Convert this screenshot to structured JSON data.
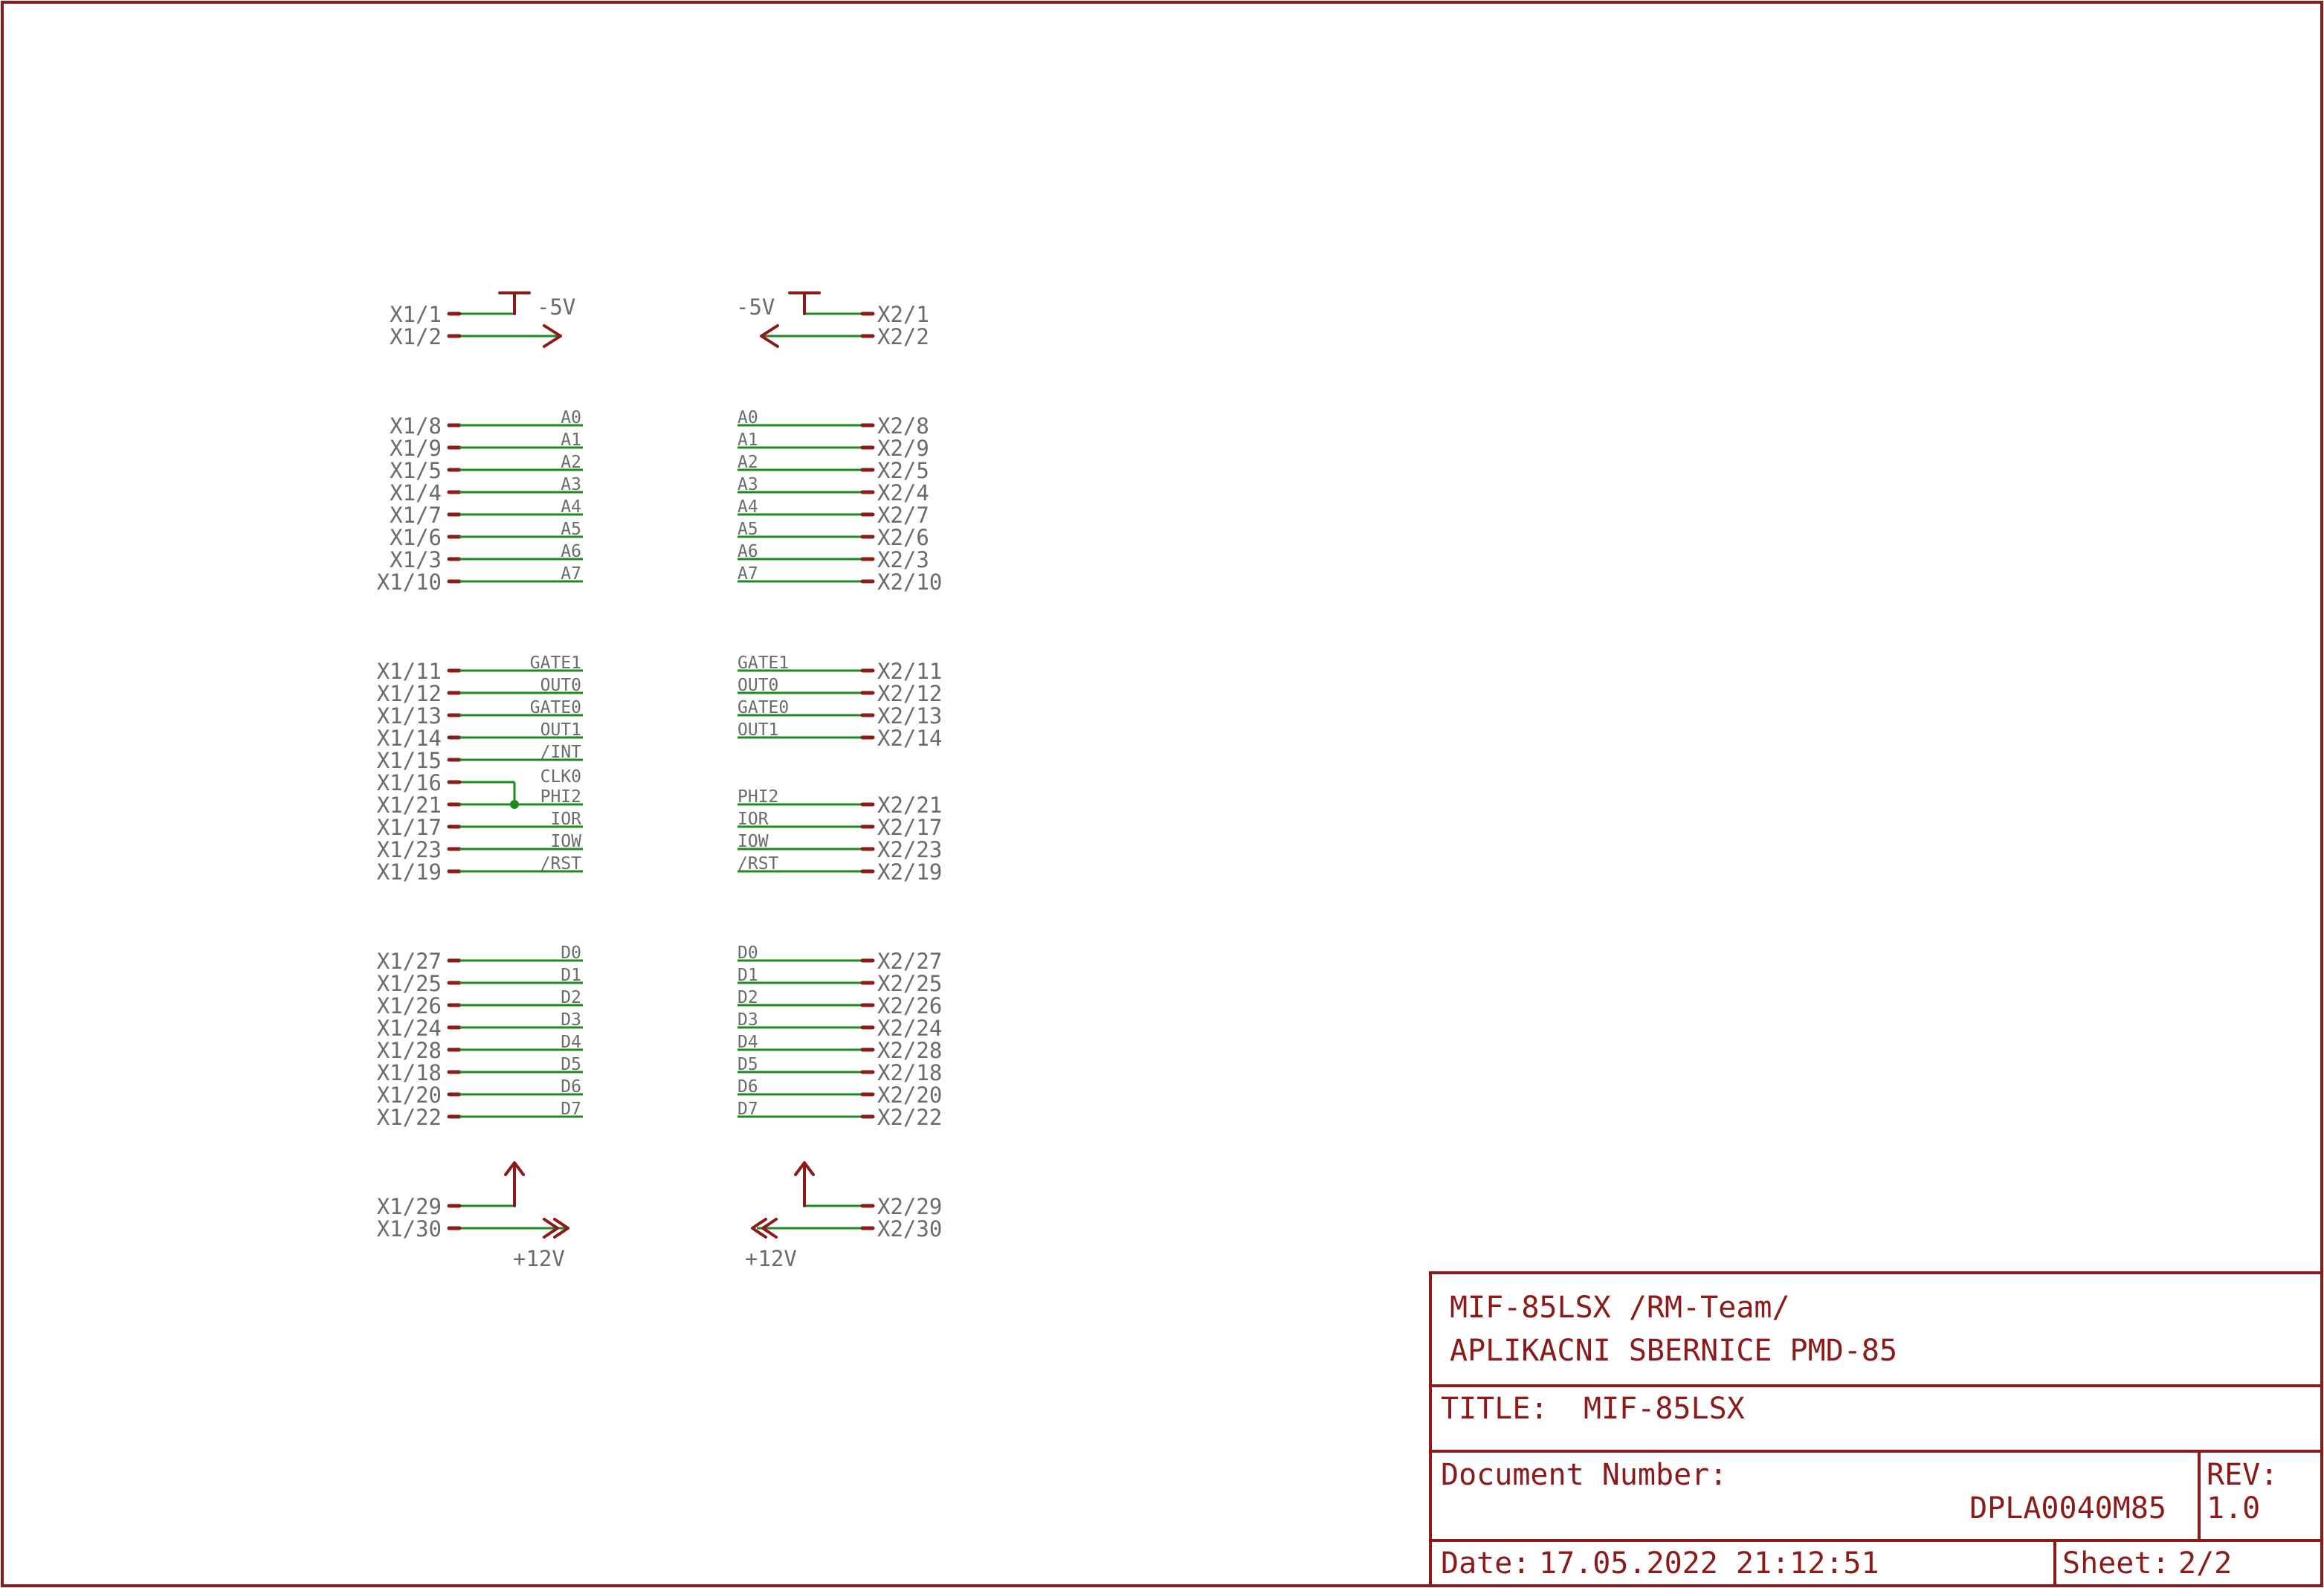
{
  "title_block": {
    "project": "MIF-85LSX /RM-Team/",
    "subtitle": "APLIKACNI SBERNICE PMD-85",
    "title_label": "TITLE:",
    "title": "MIF-85LSX",
    "doc_number_label": "Document Number:",
    "doc_number": "DPLA0040M85",
    "rev_label": "REV:",
    "rev": "1.0",
    "date_label": "Date:",
    "date": "17.05.2022 21:12:51",
    "sheet_label": "Sheet:",
    "sheet": "2/2"
  },
  "power": {
    "minus5": "-5V",
    "plus12": "+12V"
  },
  "connectors": {
    "x1": {
      "power_top": [
        "X1/1",
        "X1/2"
      ],
      "power_bottom": [
        "X1/29",
        "X1/30"
      ],
      "groups": [
        {
          "pins": [
            "X1/8",
            "X1/9",
            "X1/5",
            "X1/4",
            "X1/7",
            "X1/6",
            "X1/3",
            "X1/10"
          ],
          "signals": [
            "A0",
            "A1",
            "A2",
            "A3",
            "A4",
            "A5",
            "A6",
            "A7"
          ]
        },
        {
          "pins": [
            "X1/11",
            "X1/12",
            "X1/13",
            "X1/14",
            "X1/15",
            "X1/16",
            "X1/21",
            "X1/17",
            "X1/23",
            "X1/19"
          ],
          "signals": [
            "GATE1",
            "OUT0",
            "GATE0",
            "OUT1",
            "/INT",
            "CLK0",
            "PHI2",
            "IOR",
            "IOW",
            "/RST"
          ]
        },
        {
          "pins": [
            "X1/27",
            "X1/25",
            "X1/26",
            "X1/24",
            "X1/28",
            "X1/18",
            "X1/20",
            "X1/22"
          ],
          "signals": [
            "D0",
            "D1",
            "D2",
            "D3",
            "D4",
            "D5",
            "D6",
            "D7"
          ]
        }
      ]
    },
    "x2": {
      "power_top": [
        "X2/1",
        "X2/2"
      ],
      "power_bottom": [
        "X2/29",
        "X2/30"
      ],
      "groups": [
        {
          "pins": [
            "X2/8",
            "X2/9",
            "X2/5",
            "X2/4",
            "X2/7",
            "X2/6",
            "X2/3",
            "X2/10"
          ],
          "signals": [
            "A0",
            "A1",
            "A2",
            "A3",
            "A4",
            "A5",
            "A6",
            "A7"
          ]
        },
        {
          "pins": [
            "X2/11",
            "X2/12",
            "X2/13",
            "X2/14"
          ],
          "signals": [
            "GATE1",
            "OUT0",
            "GATE0",
            "OUT1"
          ]
        },
        {
          "pins": [
            "X2/21",
            "X2/17",
            "X2/23",
            "X2/19"
          ],
          "signals": [
            "PHI2",
            "IOR",
            "IOW",
            "/RST"
          ]
        },
        {
          "pins": [
            "X2/27",
            "X2/25",
            "X2/26",
            "X2/24",
            "X2/28",
            "X2/18",
            "X2/20",
            "X2/22"
          ],
          "signals": [
            "D0",
            "D1",
            "D2",
            "D3",
            "D4",
            "D5",
            "D6",
            "D7"
          ]
        }
      ]
    }
  },
  "colors": {
    "frame": "#8b1a1a",
    "net": "#1f8a1f",
    "text": "#6b6b6b"
  }
}
